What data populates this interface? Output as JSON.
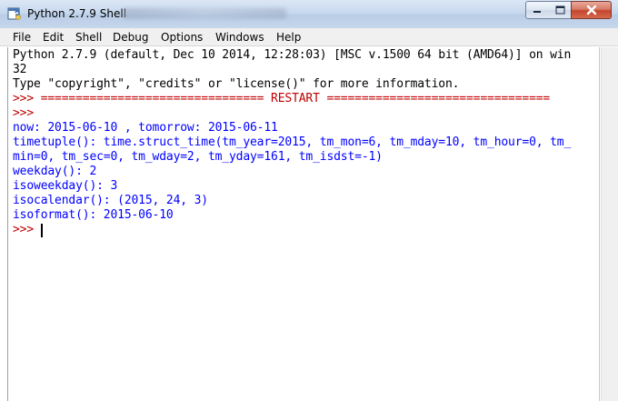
{
  "window": {
    "title": "Python 2.7.9 Shell",
    "controls": {
      "minimize_icon": "minimize-icon",
      "maximize_icon": "maximize-icon",
      "close_icon": "close-icon"
    }
  },
  "menu": [
    "File",
    "Edit",
    "Shell",
    "Debug",
    "Options",
    "Windows",
    "Help"
  ],
  "colors": {
    "stdout_blue": "#0000ff",
    "prompt_red": "#c00000",
    "banner_black": "#000000"
  },
  "shell": {
    "lines": [
      "Python 2.7.9 (default, Dec 10 2014, 12:28:03) [MSC v.1500 64 bit (AMD64)] on win",
      "32",
      "Type \"copyright\", \"credits\" or \"license()\" for more information.",
      ">>> ================================ RESTART ================================",
      ">>> ",
      "now: 2015-06-10 , tomorrow: 2015-06-11",
      "timetuple(): time.struct_time(tm_year=2015, tm_mon=6, tm_mday=10, tm_hour=0, tm_",
      "min=0, tm_sec=0, tm_wday=2, tm_yday=161, tm_isdst=-1)",
      "weekday(): 2",
      "isoweekday(): 3",
      "isocalendar(): (2015, 24, 3)",
      "isoformat(): 2015-06-10",
      ">>> "
    ]
  }
}
